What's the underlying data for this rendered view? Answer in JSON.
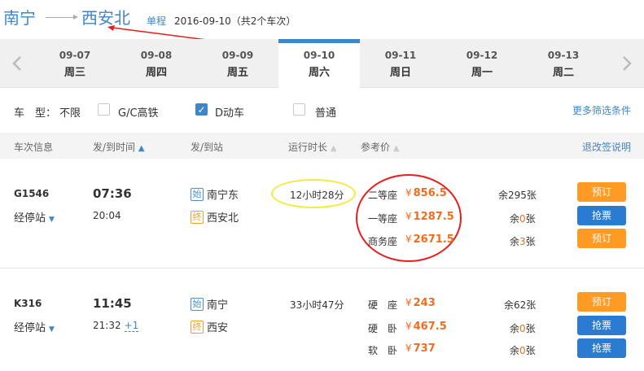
{
  "header": {
    "from": "南宁",
    "to": "西安北",
    "trip_type": "单程",
    "date_info": "2016-09-10（共2个车次）"
  },
  "dates": [
    {
      "date": "09-07",
      "weekday": "周三",
      "active": false
    },
    {
      "date": "09-08",
      "weekday": "周四",
      "active": false
    },
    {
      "date": "09-09",
      "weekday": "周五",
      "active": false
    },
    {
      "date": "09-10",
      "weekday": "周六",
      "active": true
    },
    {
      "date": "09-11",
      "weekday": "周日",
      "active": false
    },
    {
      "date": "09-12",
      "weekday": "周一",
      "active": false
    },
    {
      "date": "09-13",
      "weekday": "周二",
      "active": false
    }
  ],
  "filters": {
    "type_label": "车　型：",
    "all_label": "不限",
    "options": [
      {
        "label": "G/C高铁",
        "checked": false
      },
      {
        "label": "D动车",
        "checked": true
      },
      {
        "label": "普通",
        "checked": false
      }
    ],
    "more": "更多筛选条件"
  },
  "columns": {
    "train": "车次信息",
    "time": "发/到时间",
    "station": "发/到站",
    "duration": "运行时长",
    "price": "参考价",
    "refund": "退改签说明"
  },
  "trains": [
    {
      "no": "G1546",
      "stops": "经停站",
      "depart": "07:36",
      "arrive": "20:04",
      "arrive_plus": "",
      "from_badge": "始",
      "from": "南宁东",
      "to_badge": "终",
      "to": "西安北",
      "duration": "12小时28分",
      "seats": [
        {
          "name": "二等座",
          "yen": "¥",
          "price": "856.5",
          "remain_pre": "余",
          "remain_num": "295",
          "remain_post": "张",
          "action": "预订"
        },
        {
          "name": "一等座",
          "yen": "¥",
          "price": "1287.5",
          "remain_pre": "余",
          "remain_num": "0",
          "remain_post": "张",
          "action": "抢票"
        },
        {
          "name": "商务座",
          "yen": "¥",
          "price": "2671.5",
          "remain_pre": "余",
          "remain_num": "3",
          "remain_post": "张",
          "action": "预订"
        }
      ]
    },
    {
      "no": "K316",
      "stops": "经停站",
      "depart": "11:45",
      "arrive": "21:32",
      "arrive_plus": "+1",
      "from_badge": "始",
      "from": "南宁",
      "to_badge": "终",
      "to": "西安",
      "duration": "33小时47分",
      "seats": [
        {
          "name": "硬　座",
          "yen": "¥",
          "price": "243",
          "remain_pre": "余",
          "remain_num": "62",
          "remain_post": "张",
          "action": "预订"
        },
        {
          "name": "硬　卧",
          "yen": "¥",
          "price": "467.5",
          "remain_pre": "余",
          "remain_num": "0",
          "remain_post": "张",
          "action": "抢票"
        },
        {
          "name": "软　卧",
          "yen": "¥",
          "price": "737",
          "remain_pre": "余",
          "remain_num": "0",
          "remain_post": "张",
          "action": "抢票"
        }
      ]
    }
  ],
  "colors": {
    "accent": "#3f86c7",
    "price": "#f06d1e",
    "book_button": "#ff9b23",
    "grab_button": "#2b7bd3",
    "annotation_red": "#e81e1e",
    "annotation_yellow": "#f3ea3a"
  }
}
